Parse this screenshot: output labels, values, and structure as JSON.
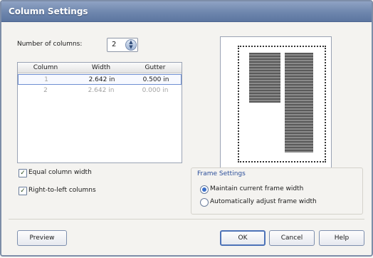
{
  "title": "Column Settings",
  "number_of_columns": {
    "label": "Number of columns:",
    "value": "2"
  },
  "table": {
    "headers": [
      "Column",
      "Width",
      "Gutter"
    ],
    "rows": [
      {
        "column": "1",
        "width": "2.642 in",
        "gutter": "0.500 in"
      },
      {
        "column": "2",
        "width": "2.642 in",
        "gutter": "0.000 in"
      }
    ]
  },
  "options": {
    "equal_width": {
      "label": "Equal column width",
      "checked": true
    },
    "rtl": {
      "label": "Right-to-left columns",
      "checked": true
    }
  },
  "frame_settings": {
    "title": "Frame Settings",
    "maintain": {
      "label": "Maintain current frame width",
      "selected": true
    },
    "adjust": {
      "label": "Automatically adjust frame width",
      "selected": false
    }
  },
  "buttons": {
    "preview": "Preview",
    "ok": "OK",
    "cancel": "Cancel",
    "help": "Help"
  },
  "icons": {
    "check": "✓",
    "spin_up": "▲",
    "spin_down": "▼"
  },
  "colors": {
    "title_bar": "#6e86ad",
    "group_title": "#2c4f9a",
    "selection": "#6f8fd2"
  }
}
